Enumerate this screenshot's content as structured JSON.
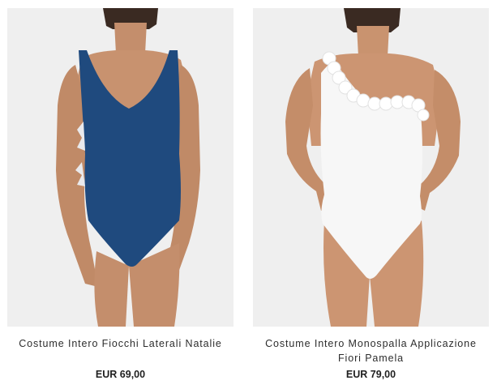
{
  "products": [
    {
      "name": "Costume Intero Fiocchi Laterali Natalie",
      "price": "EUR 69,00",
      "image_alt": "Blue one-piece swimsuit with side bows",
      "swimsuit_color": "#1f4a7e",
      "background_color": "#efefef"
    },
    {
      "name": "Costume Intero Monospalla Applicazione Fiori Pamela",
      "price": "EUR 79,00",
      "image_alt": "White one-shoulder swimsuit with ruffle flower appliqué",
      "swimsuit_color": "#f7f7f7",
      "background_color": "#efefef"
    }
  ]
}
